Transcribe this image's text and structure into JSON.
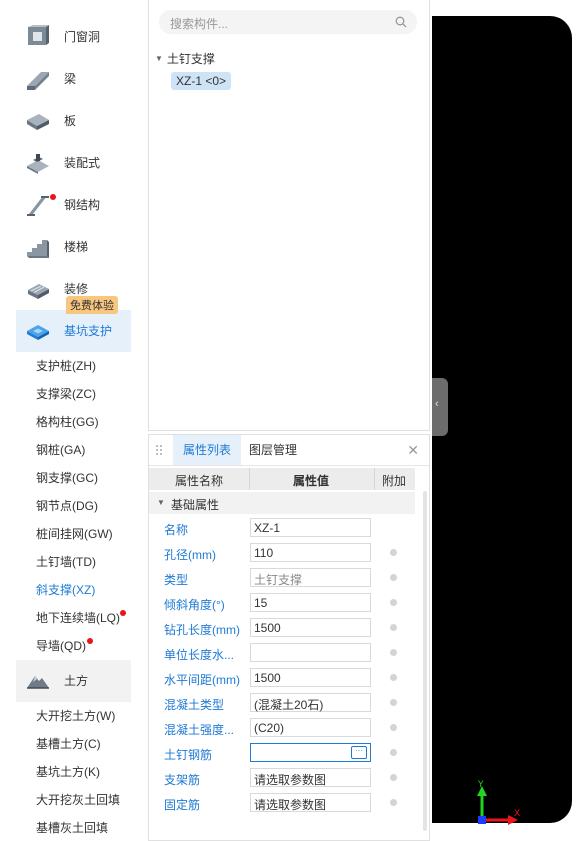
{
  "sidebar": {
    "categories": [
      {
        "label": "门窗洞",
        "icon": "door-window-icon"
      },
      {
        "label": "梁",
        "icon": "beam-icon"
      },
      {
        "label": "板",
        "icon": "slab-icon"
      },
      {
        "label": "装配式",
        "icon": "prefab-icon"
      },
      {
        "label": "钢结构",
        "icon": "steel-structure-icon"
      },
      {
        "label": "楼梯",
        "icon": "stairs-icon"
      },
      {
        "label": "装修",
        "icon": "decoration-icon"
      },
      {
        "label": "基坑支护",
        "icon": "foundation-pit-icon"
      }
    ],
    "badge": "免费体验",
    "subitems": [
      {
        "label": "支护桩(ZH)"
      },
      {
        "label": "支撑梁(ZC)"
      },
      {
        "label": "格构柱(GG)"
      },
      {
        "label": "钢桩(GA)"
      },
      {
        "label": "钢支撑(GC)"
      },
      {
        "label": "钢节点(DG)"
      },
      {
        "label": "桩间挂网(GW)"
      },
      {
        "label": "土钉墙(TD)"
      },
      {
        "label": "斜支撑(XZ)"
      },
      {
        "label": "地下连续墙(LQ)"
      },
      {
        "label": "导墙(QD)"
      }
    ],
    "earthwork": {
      "label": "土方",
      "icon": "earthwork-icon"
    },
    "earth_subitems": [
      {
        "label": "大开挖土方(W)"
      },
      {
        "label": "基槽土方(C)"
      },
      {
        "label": "基坑土方(K)"
      },
      {
        "label": "大开挖灰土回填"
      },
      {
        "label": "基槽灰土回填"
      }
    ]
  },
  "tree": {
    "search_placeholder": "搜索构件...",
    "group": "土钉支撑",
    "item": "XZ-1 <0>"
  },
  "props": {
    "tabs": [
      "属性列表",
      "图层管理"
    ],
    "headers": [
      "属性名称",
      "属性值",
      "附加"
    ],
    "group": "基础属性",
    "rows": [
      {
        "name": "名称",
        "value": "XZ-1"
      },
      {
        "name": "孔径(mm)",
        "value": "110"
      },
      {
        "name": "类型",
        "value": "土钉支撑"
      },
      {
        "name": "倾斜角度(°)",
        "value": "15"
      },
      {
        "name": "钻孔长度(mm)",
        "value": "1500"
      },
      {
        "name": "单位长度水...",
        "value": ""
      },
      {
        "name": "水平间距(mm)",
        "value": "1500"
      },
      {
        "name": "混凝土类型",
        "value": "(混凝土20石)"
      },
      {
        "name": "混凝土强度...",
        "value": "(C20)"
      },
      {
        "name": "土钉钢筋",
        "value": ""
      },
      {
        "name": "支架筋",
        "value": "请选取参数图"
      },
      {
        "name": "固定筋",
        "value": "请选取参数图"
      }
    ],
    "more_button": "···"
  },
  "canvas": {
    "axis_y": "Y",
    "axis_x": "X"
  },
  "colors": {
    "accent": "#1e7ad4",
    "badge": "#f9c680",
    "dot": "#e8151b",
    "canvas": "#000000"
  }
}
